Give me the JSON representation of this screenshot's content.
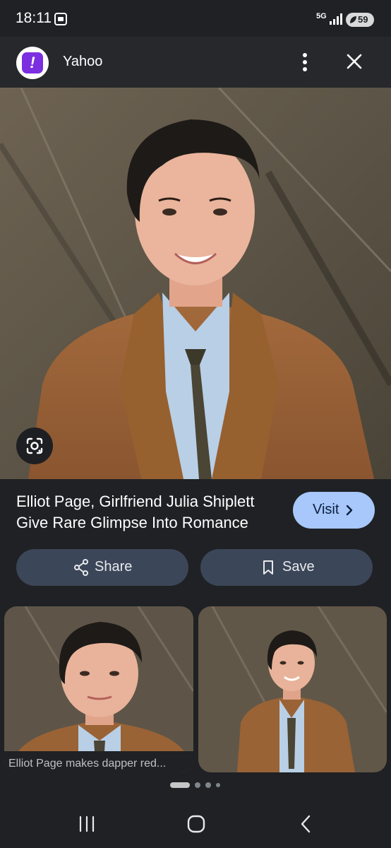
{
  "status_bar": {
    "time": "18:11",
    "network": "5G",
    "battery": "59",
    "icons": [
      "screenshot-icon",
      "signal-icon",
      "battery-icon"
    ]
  },
  "header": {
    "site_name": "Yahoo",
    "favicon_glyph": "!",
    "favicon_color": "#7b2fe0",
    "icons": [
      "more-vert-icon",
      "close-icon"
    ]
  },
  "result": {
    "title": "Elliot Page, Girlfriend Julia Shiplett Give Rare Glimpse Into Romance",
    "visit_label": "Visit",
    "share_label": "Share",
    "save_label": "Save"
  },
  "related": [
    {
      "caption": "Elliot Page makes dapper red..."
    },
    {
      "caption": ""
    }
  ],
  "pager": {
    "dot_count": 4,
    "active_index": 0
  },
  "colors": {
    "accent": "#a8c7fa",
    "pill": "#3b4658",
    "background": "#1f2124"
  }
}
